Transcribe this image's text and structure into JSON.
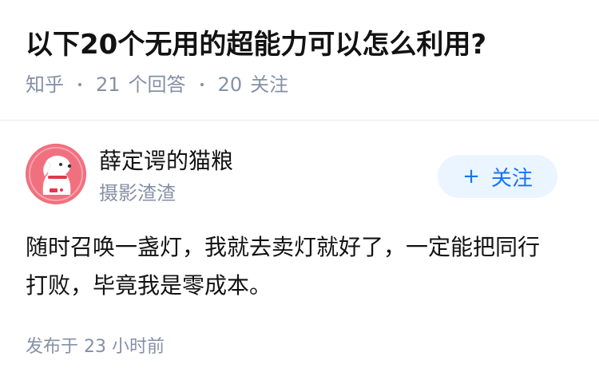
{
  "question": {
    "title": "以下20个无用的超能力可以怎么利用?",
    "source": "知乎",
    "answers_count": "21",
    "answers_label": "个回答",
    "followers_count": "20",
    "followers_label": "关注"
  },
  "answer": {
    "author": {
      "name": "薛定谔的猫粮",
      "bio": "摄影渣渣",
      "avatar_icon": "cartoon-dog-avatar-icon"
    },
    "follow_button": {
      "icon": "plus-icon",
      "plus": "+",
      "label": "关注"
    },
    "content": "随时召唤一盏灯，我就去卖灯就好了，一定能把同行打败，毕竟我是零成本。",
    "published": "发布于 23 小时前"
  },
  "colors": {
    "title": "#121212",
    "meta": "#8590a6",
    "accent": "#1772f6",
    "button_bg": "#ebf5ff",
    "avatar_bg": "#f1707f"
  }
}
